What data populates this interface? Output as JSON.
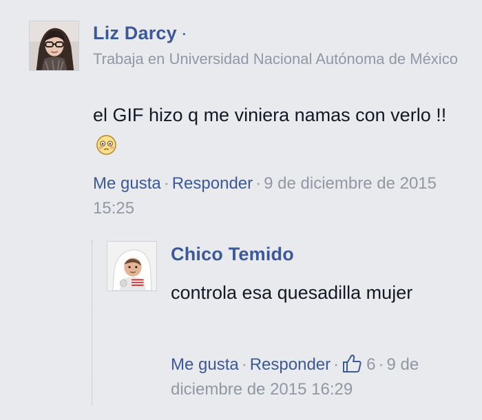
{
  "comment": {
    "author": "Liz Darcy",
    "name_dot": "·",
    "workplace": "Trabaja en Universidad Nacional Autónoma de México",
    "text": "el GIF hizo q me viniera namas con verlo !!",
    "emoji_icon": "flushed-face-emoji-icon",
    "like_label": "Me gusta",
    "reply_label": "Responder",
    "separator": "·",
    "timestamp": "9 de diciembre de 2015 15:25"
  },
  "reply": {
    "author": "Chico Temido",
    "text": "controla esa quesadilla mujer",
    "like_label": "Me gusta",
    "reply_label": "Responder",
    "separator": "·",
    "like_icon": "thumbs-up-icon",
    "like_count": "6",
    "timestamp": "9 de diciembre de 2015 16:29"
  },
  "colors": {
    "background": "#e9eaed",
    "link": "#3b5998",
    "meta": "#9197a3",
    "text": "#141823"
  }
}
